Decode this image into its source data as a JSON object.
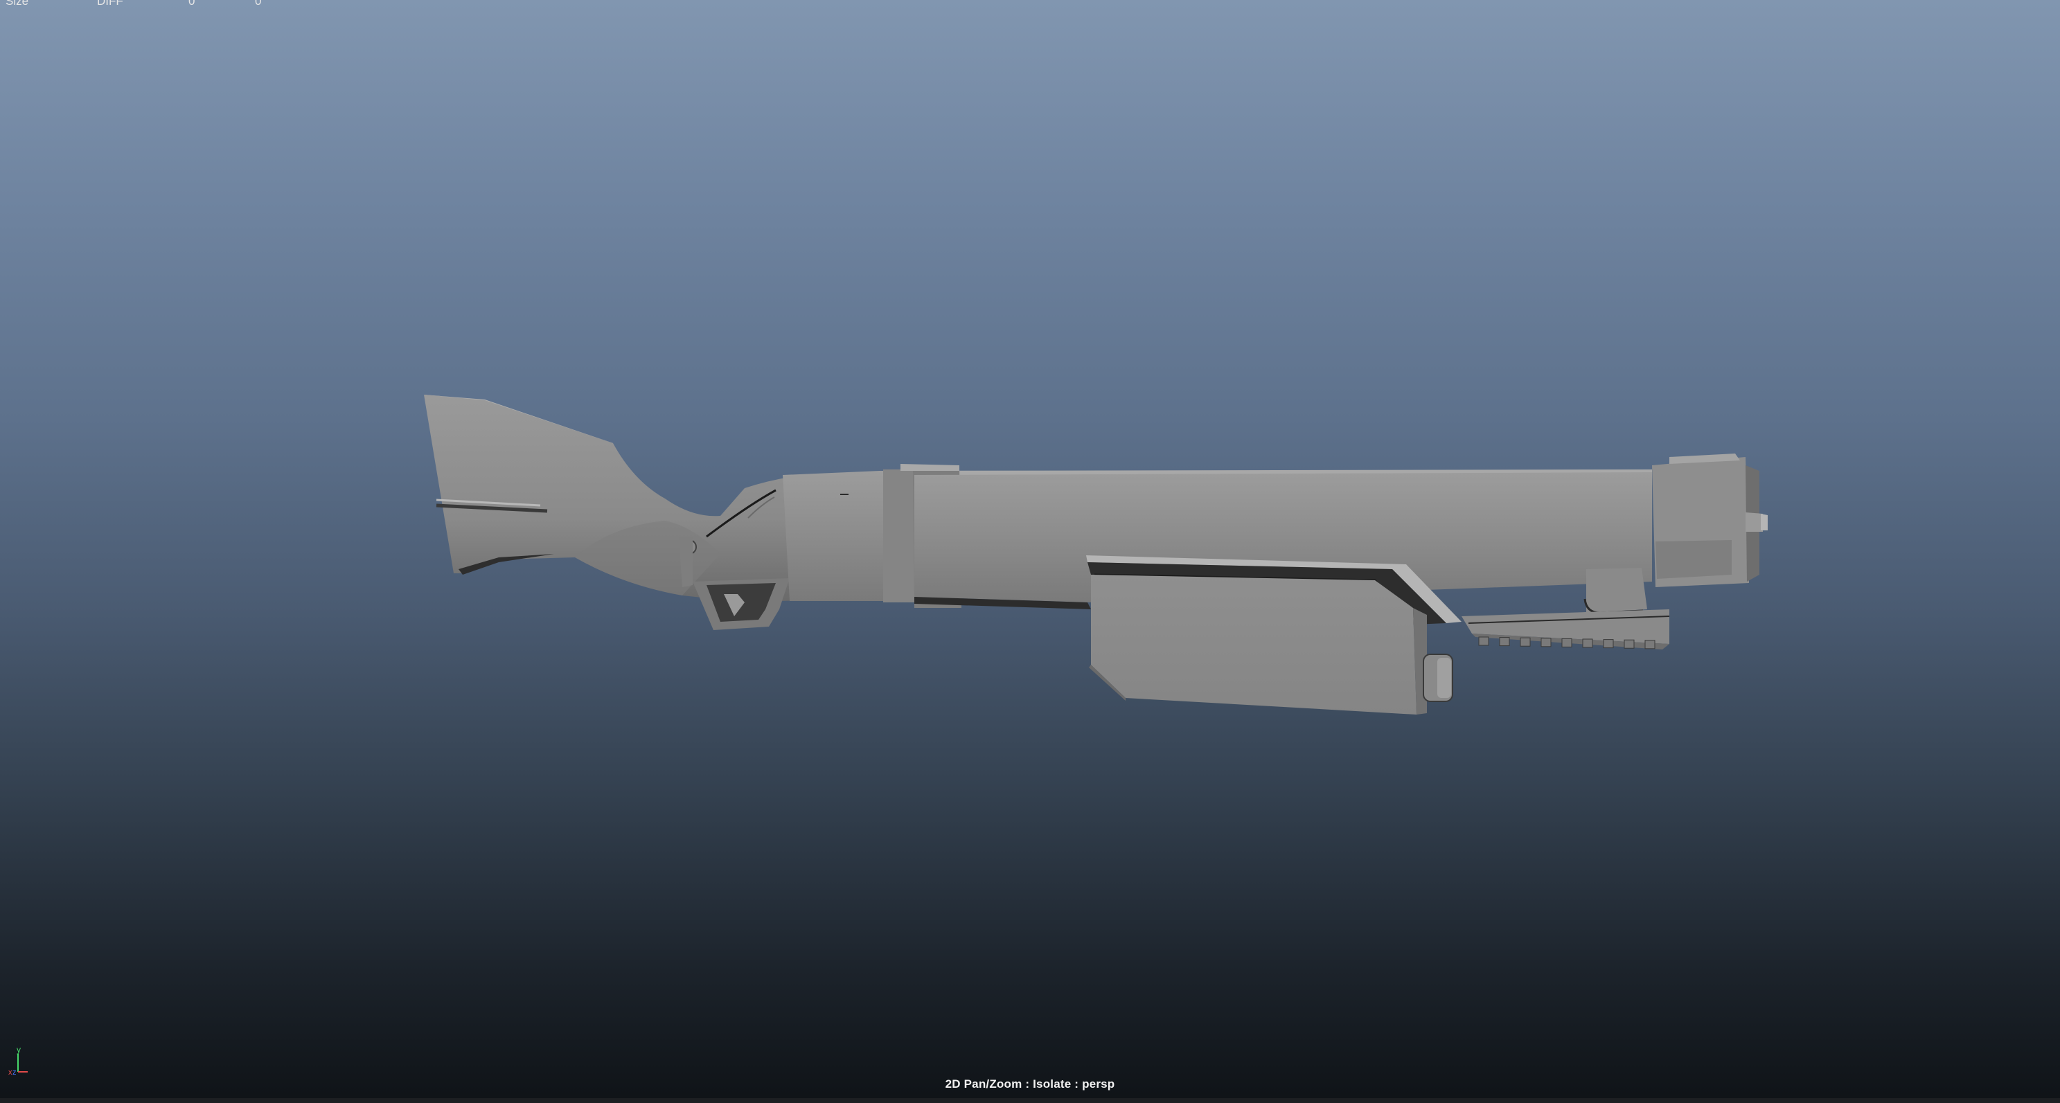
{
  "viewport": {
    "hud_label": "2D Pan/Zoom : Isolate : persp",
    "camera": "persp",
    "mode": "2D Pan/Zoom",
    "isolate": "Isolate",
    "top_fragments": [
      "Size",
      "DIFF",
      "0",
      "0"
    ]
  },
  "axis_gizmo": {
    "y_label": "y",
    "x_label": "x",
    "z_label": "z",
    "colors": {
      "y": "#47d86a",
      "x": "#e24b4b",
      "z": "#4a78ff"
    }
  },
  "model": {
    "name": "shotgun-mesh",
    "shading": "default-gray",
    "color": "#8a8a8a"
  },
  "colors": {
    "gradient_top": "#8196b0",
    "gradient_bottom": "#0f1317",
    "mesh_base": "#8a8a8a",
    "mesh_light": "#9c9c9c",
    "mesh_dark": "#4e4e4e",
    "edge": "#1b1b1b"
  }
}
